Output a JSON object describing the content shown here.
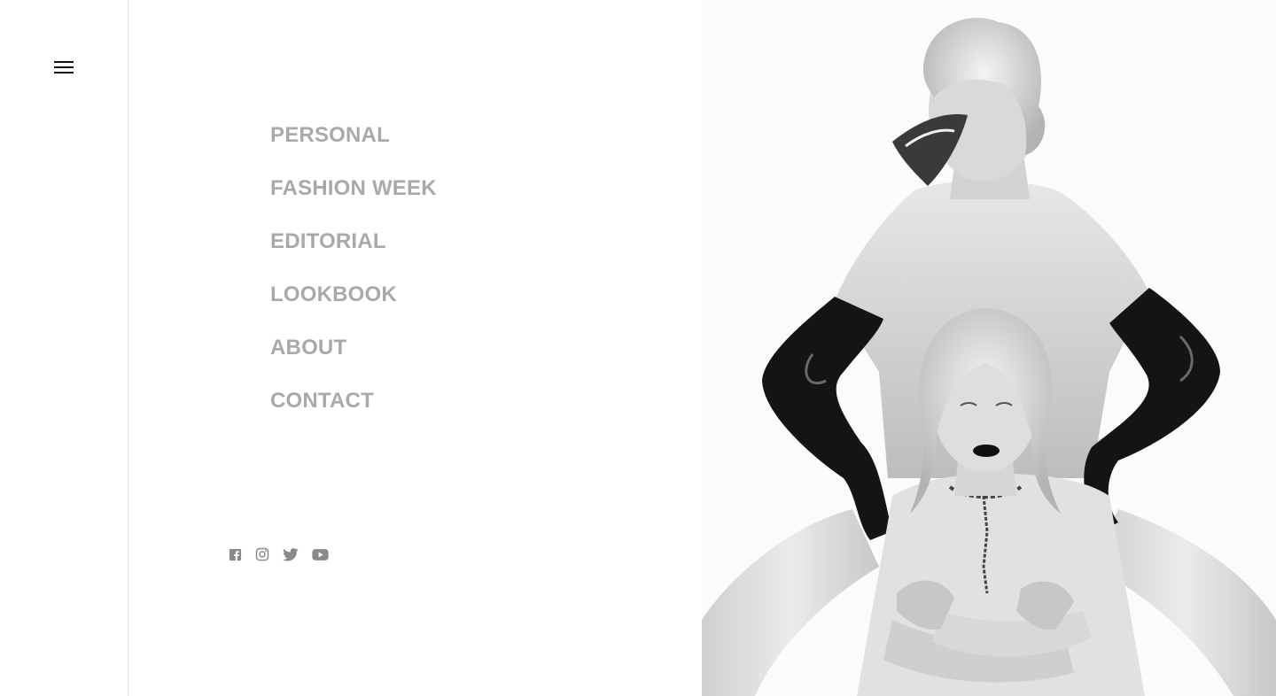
{
  "menu": {
    "icon": "hamburger-menu-icon"
  },
  "nav": {
    "items": [
      {
        "label": "PERSONAL"
      },
      {
        "label": "FASHION WEEK"
      },
      {
        "label": "EDITORIAL"
      },
      {
        "label": "LOOKBOOK"
      },
      {
        "label": "ABOUT"
      },
      {
        "label": "CONTACT"
      }
    ],
    "color": "#a9a9a9"
  },
  "social": {
    "icons": [
      "facebook-icon",
      "instagram-icon",
      "twitter-icon",
      "youtube-icon"
    ],
    "color": "#8a8a8a"
  },
  "hero": {
    "image": "black-and-white fashion photograph"
  }
}
